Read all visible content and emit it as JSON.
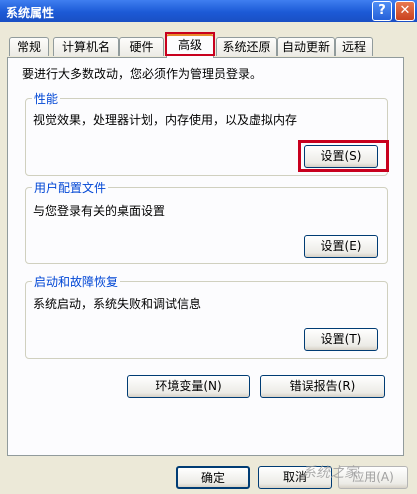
{
  "window": {
    "title": "系统属性",
    "help_button": "?",
    "close_button": "✕"
  },
  "tabs": [
    {
      "label": "常规"
    },
    {
      "label": "计算机名"
    },
    {
      "label": "硬件"
    },
    {
      "label": "高级"
    },
    {
      "label": "系统还原"
    },
    {
      "label": "自动更新"
    },
    {
      "label": "远程"
    }
  ],
  "active_tab": "高级",
  "panel": {
    "admin_note": "要进行大多数改动，您必须作为管理员登录。",
    "performance": {
      "title": "性能",
      "description": "视觉效果，处理器计划，内存使用，以及虚拟内存",
      "button": "设置(S)"
    },
    "user_profiles": {
      "title": "用户配置文件",
      "description": "与您登录有关的桌面设置",
      "button": "设置(E)"
    },
    "startup_recovery": {
      "title": "启动和故障恢复",
      "description": "系统启动，系统失败和调试信息",
      "button": "设置(T)"
    },
    "env_vars_button": "环境变量(N)",
    "error_report_button": "错误报告(R)"
  },
  "footer": {
    "ok_button": "确定",
    "cancel_button": "取消",
    "apply_button": "应用(A)"
  },
  "watermark": "系统之家",
  "colors": {
    "highlight": "#c8001e",
    "group_title": "#0046d5"
  }
}
